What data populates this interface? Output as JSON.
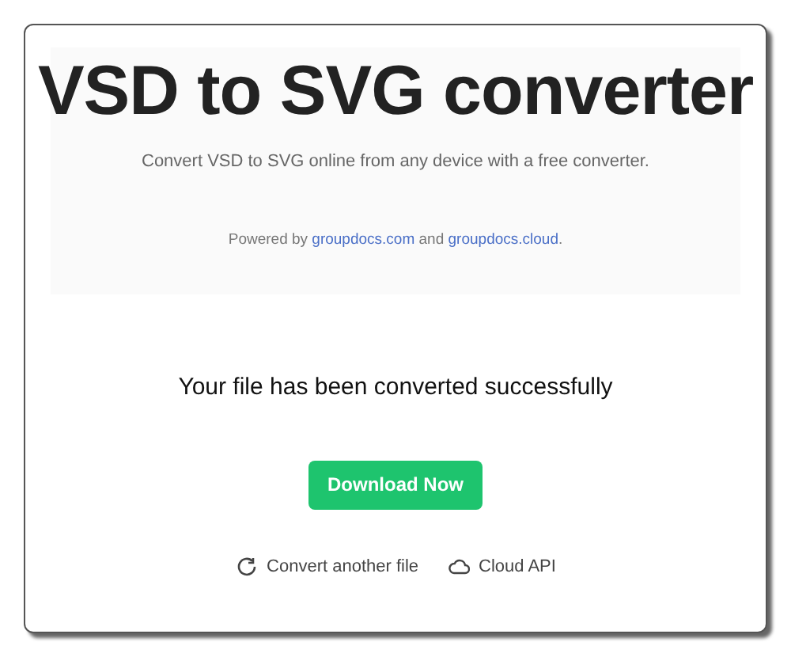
{
  "header": {
    "title": "VSD to SVG converter",
    "subtitle": "Convert VSD to SVG online from any device with a free converter.",
    "powered_by": {
      "before": "Powered by",
      "links": [
        "groupdocs.com",
        "groupdocs.cloud"
      ],
      "between": "and",
      "after": "."
    }
  },
  "result": {
    "message": "Your file has been converted successfully",
    "download_button": "Download Now",
    "actions": [
      {
        "kind": "refresh",
        "label": "Convert another file"
      },
      {
        "kind": "cloud",
        "label": "Cloud API"
      }
    ]
  }
}
